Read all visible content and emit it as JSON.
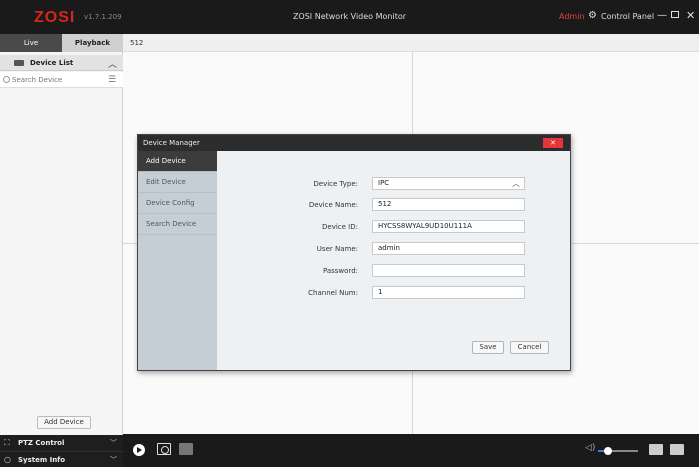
{
  "titlebar": {
    "logo": "ZOSI",
    "version": "v1.7.1.209",
    "title": "ZOSI Network Video Monitor",
    "user": "Admin",
    "control_panel": "Control Panel",
    "min_symbol": "—",
    "close_symbol": "✕"
  },
  "sidebar": {
    "tabs": [
      {
        "label": "Live",
        "active": true
      },
      {
        "label": "Playback",
        "active": false
      }
    ],
    "device_list": {
      "label": "Device List",
      "search_placeholder": "Search Device"
    },
    "add_device": "Add Device",
    "ptz": {
      "label": "PTZ Control"
    },
    "system_info": {
      "label": "System Info"
    }
  },
  "main": {
    "tab_label": "512"
  },
  "dialog": {
    "title": "Device Manager",
    "close": "✕",
    "nav": [
      {
        "label": "Add Device",
        "active": true
      },
      {
        "label": "Edit Device",
        "active": false
      },
      {
        "label": "Device Config",
        "active": false
      },
      {
        "label": "Search Device",
        "active": false
      }
    ],
    "form": {
      "device_type": {
        "label": "Device Type:",
        "value": "IPC"
      },
      "device_name": {
        "label": "Device Name:",
        "value": "512"
      },
      "device_id": {
        "label": "Device ID:",
        "value": "HYCSS8WYAL9UD10U111A"
      },
      "user_name": {
        "label": "User Name:",
        "value": "admin"
      },
      "password": {
        "label": "Password:",
        "value": ""
      },
      "channel_num": {
        "label": "Channel Num:",
        "value": "1"
      }
    },
    "save": "Save",
    "cancel": "Cancel"
  },
  "bottombar": {
    "volume_level": 0.15
  },
  "colors": {
    "brand": "#d9231f",
    "admin_text": "#e2403a",
    "close_button": "#e6353a",
    "dark_bar": "#1a1a1a",
    "dialog_nav": "#c5ced6"
  }
}
